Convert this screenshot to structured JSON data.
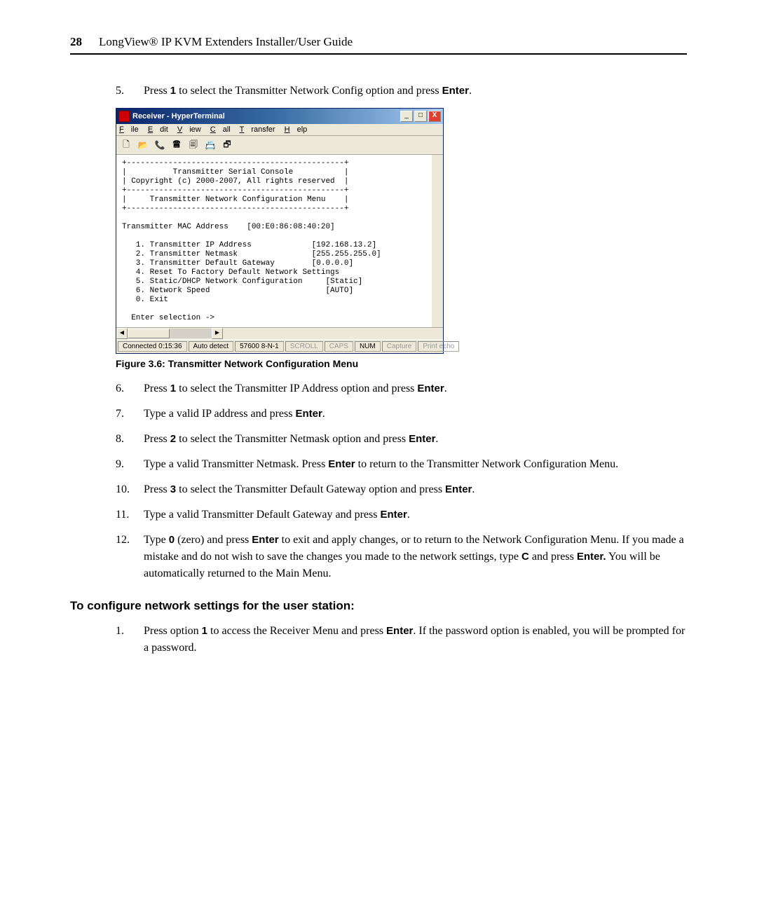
{
  "header": {
    "page_number": "28",
    "title": "LongView® IP KVM Extenders Installer/User Guide"
  },
  "step5": {
    "num": "5.",
    "pre": "Press ",
    "key": "1",
    "mid": " to select the Transmitter Network Config option and press ",
    "enter": "Enter",
    "post": "."
  },
  "hyperterminal": {
    "title": "Receiver - HyperTerminal",
    "buttons": {
      "min": "_",
      "max": "□",
      "close": "X"
    },
    "menu": {
      "file": "File",
      "edit": "Edit",
      "view": "View",
      "call": "Call",
      "transfer": "Transfer",
      "help": "Help"
    },
    "toolbar": [
      "🗋",
      "📂",
      "📞",
      "🖀",
      "🗐",
      "📇",
      "🗗"
    ],
    "terminal_lines": [
      "+-----------------------------------------------+",
      "|          Transmitter Serial Console           |",
      "| Copyright (c) 2000-2007, All rights reserved  |",
      "+-----------------------------------------------+",
      "|     Transmitter Network Configuration Menu    |",
      "+-----------------------------------------------+",
      "",
      "Transmitter MAC Address    [00:E0:86:08:40:20]",
      "",
      "   1. Transmitter IP Address             [192.168.13.2]",
      "   2. Transmitter Netmask                [255.255.255.0]",
      "   3. Transmitter Default Gateway        [0.0.0.0]",
      "   4. Reset To Factory Default Network Settings",
      "   5. Static/DHCP Network Configuration     [Static]",
      "   6. Network Speed                         [AUTO]",
      "   0. Exit",
      "",
      "  Enter selection ->",
      ""
    ],
    "status": {
      "connected": "Connected 0:15:36",
      "detect": "Auto detect",
      "baud": "57600 8-N-1",
      "scroll": "SCROLL",
      "caps": "CAPS",
      "num": "NUM",
      "capture": "Capture",
      "print": "Print echo"
    }
  },
  "figure_caption": "Figure 3.6: Transmitter Network Configuration Menu",
  "step6": {
    "num": "6.",
    "pre": "Press ",
    "k": "1",
    "mid": " to select the Transmitter IP Address option and press ",
    "e": "Enter",
    "post": "."
  },
  "step7": {
    "num": "7.",
    "pre": "Type a valid IP address and press ",
    "e": "Enter",
    "post": "."
  },
  "step8": {
    "num": "8.",
    "pre": "Press ",
    "k": "2",
    "mid": " to select the Transmitter Netmask option and press ",
    "e": "Enter",
    "post": "."
  },
  "step9": {
    "num": "9.",
    "pre": "Type a valid Transmitter Netmask. Press ",
    "e": "Enter",
    "post": " to return to the Transmitter Network Configuration Menu."
  },
  "step10": {
    "num": "10.",
    "pre": "Press ",
    "k": "3",
    "mid": " to select the Transmitter Default Gateway option and press ",
    "e": "Enter",
    "post": "."
  },
  "step11": {
    "num": "11.",
    "pre": "Type a valid Transmitter Default Gateway and press ",
    "e": "Enter",
    "post": "."
  },
  "step12": {
    "num": "12.",
    "t1": "Type ",
    "k0": "0",
    "t2": " (zero) and press ",
    "e1": "Enter",
    "t3": " to exit and apply changes, or to return to the Network Configuration Menu. If you made a mistake and do not wish to save the changes you made to the network settings, type ",
    "kc": "C",
    "t4": " and press ",
    "e2": "Enter.",
    "t5": " You will be automatically returned to the Main Menu."
  },
  "subheading": "To configure network settings for the user station:",
  "us_step1": {
    "num": "1.",
    "pre": "Press option ",
    "k": "1",
    "mid": " to access the Receiver Menu and press ",
    "e": "Enter",
    "post": ". If the password option is enabled, you will be prompted for a password."
  }
}
